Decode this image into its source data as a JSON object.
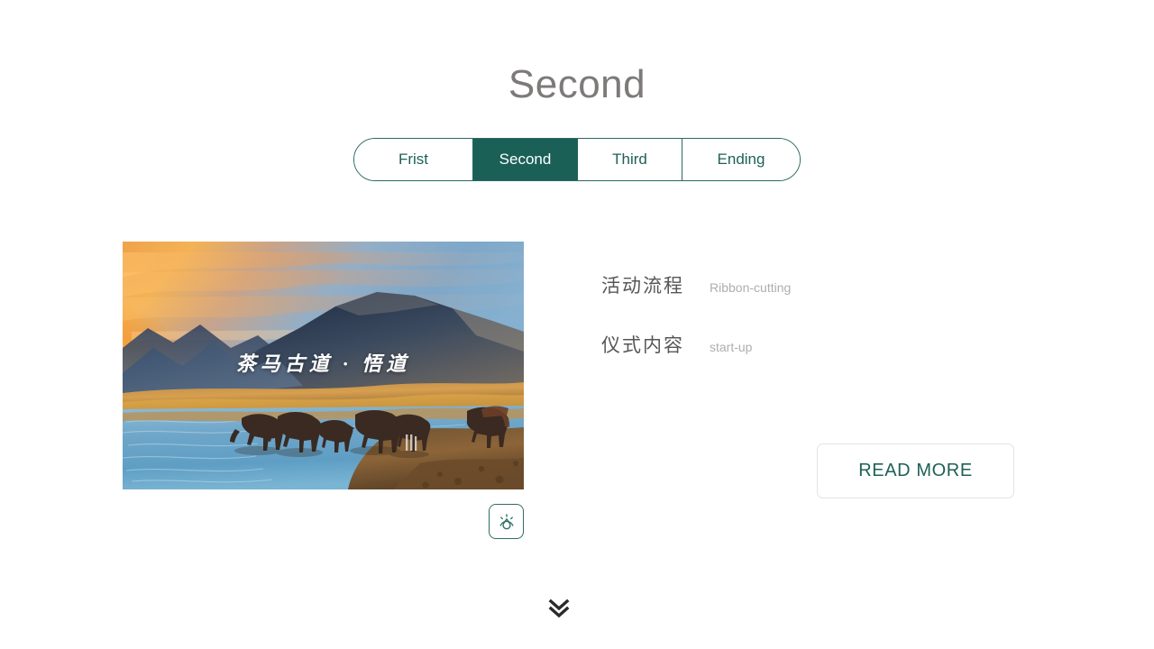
{
  "page": {
    "title": "Second",
    "background_color": "#ffffff",
    "title_color": "#7d7a79"
  },
  "theme": {
    "accent": "#1a6057",
    "accent_text": "#1d6157",
    "muted_text": "#aeaeae",
    "label_text": "#575757",
    "border_light": "#e3e3e3"
  },
  "tabs": {
    "active_index": 1,
    "items": [
      {
        "label": "Frist"
      },
      {
        "label": "Second"
      },
      {
        "label": "Third"
      },
      {
        "label": "Ending"
      }
    ]
  },
  "hero": {
    "caption": "茶马古道 · 悟道",
    "alt": "sunset-mountain-lake-horses-photo"
  },
  "icon_chip": {
    "icon": "humidity-drop-icon"
  },
  "details": [
    {
      "label": "活动流程",
      "value": "Ribbon-cutting"
    },
    {
      "label": "仪式内容",
      "value": "start-up"
    }
  ],
  "read_more": {
    "label": "READ MORE"
  },
  "scroll_hint": {
    "icon": "double-chevron-down-icon"
  }
}
